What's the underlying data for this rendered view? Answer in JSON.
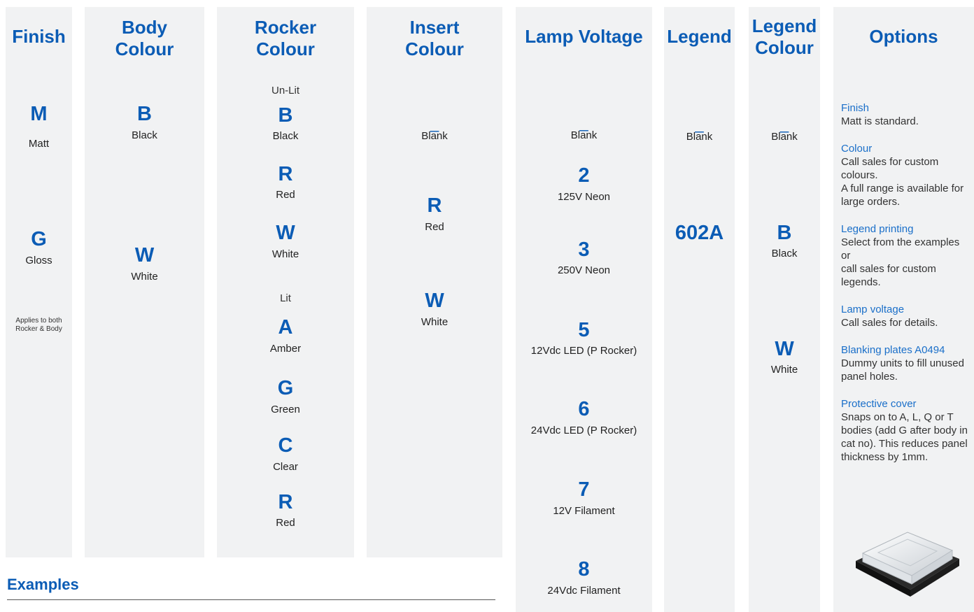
{
  "finish": {
    "title": "Finish",
    "items": [
      {
        "code": "M",
        "label": "Matt"
      },
      {
        "code": "G",
        "label": "Gloss"
      }
    ],
    "note_line1": "Applies to both",
    "note_line2": "Rocker & Body"
  },
  "body_colour": {
    "title_line1": "Body",
    "title_line2": "Colour",
    "items": [
      {
        "code": "B",
        "label": "Black"
      },
      {
        "code": "W",
        "label": "White"
      }
    ]
  },
  "rocker_colour": {
    "title_line1": "Rocker",
    "title_line2": "Colour",
    "unlit_label": "Un-Lit",
    "lit_label": "Lit",
    "items": [
      {
        "code": "B",
        "label": "Black"
      },
      {
        "code": "R",
        "label": "Red"
      },
      {
        "code": "W",
        "label": "White"
      },
      {
        "code": "A",
        "label": "Amber"
      },
      {
        "code": "G",
        "label": "Green"
      },
      {
        "code": "C",
        "label": "Clear"
      },
      {
        "code": "R",
        "label": "Red"
      }
    ]
  },
  "insert_colour": {
    "title_line1": "Insert",
    "title_line2": "Colour",
    "items": [
      {
        "code": "_",
        "label": "Blank"
      },
      {
        "code": "R",
        "label": "Red"
      },
      {
        "code": "W",
        "label": "White"
      }
    ]
  },
  "lamp_voltage": {
    "title": "Lamp Voltage",
    "items": [
      {
        "code": "_",
        "label": "Blank"
      },
      {
        "code": "2",
        "label": "125V Neon"
      },
      {
        "code": "3",
        "label": "250V Neon"
      },
      {
        "code": "5",
        "label": "12Vdc LED (P Rocker)"
      },
      {
        "code": "6",
        "label": "24Vdc LED (P Rocker)"
      },
      {
        "code": "7",
        "label": "12V Filament"
      },
      {
        "code": "8",
        "label": "24Vdc Filament"
      }
    ]
  },
  "legend": {
    "title": "Legend",
    "items": [
      {
        "code": "_",
        "label": "Blank"
      },
      {
        "code": "602A"
      }
    ]
  },
  "legend_colour": {
    "title_line1": "Legend",
    "title_line2": "Colour",
    "items": [
      {
        "code": "_",
        "label": "Blank"
      },
      {
        "code": "B",
        "label": "Black"
      },
      {
        "code": "W",
        "label": "White"
      }
    ]
  },
  "options": {
    "title": "Options",
    "sections": [
      {
        "title": "Finish",
        "lines": [
          "Matt is standard."
        ]
      },
      {
        "title": "Colour",
        "lines": [
          "Call sales for custom",
          "colours.",
          "A full range is available for",
          "large orders."
        ]
      },
      {
        "title": "Legend printing",
        "lines": [
          "Select from the examples",
          "or",
          "call sales for custom",
          "legends."
        ]
      },
      {
        "title": "Lamp voltage",
        "lines": [
          "Call sales for details."
        ]
      },
      {
        "title": "Blanking plates A0494",
        "lines": [
          "Dummy units to fill unused",
          "panel holes."
        ]
      },
      {
        "title": "Protective cover",
        "lines": [
          "Snaps on to A, L, Q or T",
          "bodies (add G after body in",
          "cat no). This reduces panel",
          "thickness by 1mm."
        ]
      }
    ]
  },
  "examples_title": "Examples",
  "colors": {
    "accent": "#0b5cb5",
    "column_bg": "#f1f2f3"
  }
}
